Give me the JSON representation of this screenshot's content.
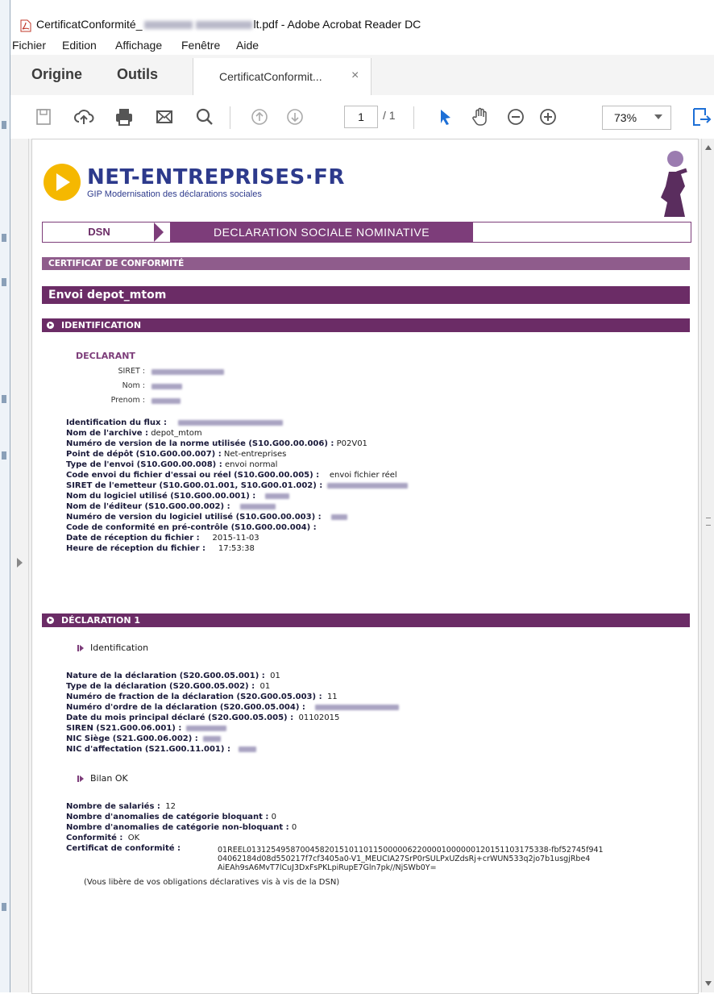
{
  "window": {
    "title_prefix": "CertificatConformité_",
    "title_suffix": "lt.pdf - Adobe Acrobat Reader DC"
  },
  "menu": [
    "Fichier",
    "Edition",
    "Affichage",
    "Fenêtre",
    "Aide"
  ],
  "tabs": {
    "home": "Origine",
    "tools": "Outils",
    "document": "CertificatConformit...",
    "close": "×"
  },
  "toolbar": {
    "page_current": "1",
    "page_total": "/ 1",
    "zoom": "73%"
  },
  "doc": {
    "logo_title": "NET-ENTREPRISES·FR",
    "logo_subtitle": "GIP Modernisation des déclarations sociales",
    "dsn": "DSN",
    "dsn_full": "DECLARATION SOCIALE NOMINATIVE",
    "cert_header": "CERTIFICAT DE CONFORMITÉ",
    "envoi": "Envoi depot_mtom",
    "identification_header": "IDENTIFICATION",
    "declarant": "DECLARANT",
    "declarant_fields": [
      {
        "label": "SIRET :"
      },
      {
        "label": "Nom :"
      },
      {
        "label": "Prenom :"
      }
    ],
    "ident_fields": [
      {
        "label": "Identification du flux :",
        "value": ""
      },
      {
        "label": "Nom de l'archive :",
        "value": "depot_mtom"
      },
      {
        "label": "Numéro de version de la norme utilisée (S10.G00.00.006) :",
        "value": "P02V01"
      },
      {
        "label": "Point de dépôt (S10.G00.00.007) :",
        "value": "Net-entreprises"
      },
      {
        "label": "Type de l'envoi (S10.G00.00.008) :",
        "value": "envoi normal"
      },
      {
        "label": "Code envoi du fichier d'essai ou réel (S10.G00.00.005) :",
        "value": "envoi fichier réel"
      },
      {
        "label": "SIRET de l'emetteur (S10.G00.01.001, S10.G00.01.002) :",
        "value": ""
      },
      {
        "label": "Nom du logiciel utilisé (S10.G00.00.001) :",
        "value": ""
      },
      {
        "label": "Nom de l'éditeur (S10.G00.00.002) :",
        "value": ""
      },
      {
        "label": "Numéro de version du logiciel utilisé (S10.G00.00.003) :",
        "value": ""
      },
      {
        "label": "Code de conformité en pré-contrôle (S10.G00.00.004) :",
        "value": ""
      },
      {
        "label": "Date de réception du fichier :",
        "value": "2015-11-03"
      },
      {
        "label": "Heure de réception du fichier :",
        "value": "17:53:38"
      }
    ],
    "declaration_header": "DÉCLARATION 1",
    "identification_link": "Identification",
    "decl_fields": [
      {
        "label": "Nature de la déclaration (S20.G00.05.001) :",
        "value": "01"
      },
      {
        "label": "Type de la déclaration (S20.G00.05.002) :",
        "value": "01"
      },
      {
        "label": "Numéro de fraction de la déclaration (S20.G00.05.003) :",
        "value": "11"
      },
      {
        "label": "Numéro d'ordre de la déclaration (S20.G00.05.004) :",
        "value": ""
      },
      {
        "label": "Date du mois principal déclaré (S20.G00.05.005) :",
        "value": "01102015"
      },
      {
        "label": "SIREN (S21.G00.06.001) :",
        "value": ""
      },
      {
        "label": "NIC Siège (S21.G00.06.002) :",
        "value": ""
      },
      {
        "label": "NIC d'affectation (S21.G00.11.001) :",
        "value": ""
      }
    ],
    "bilan_link": "Bilan OK",
    "bilan_fields": [
      {
        "label": "Nombre de salariés :",
        "value": "12"
      },
      {
        "label": "Nombre d'anomalies de catégorie bloquant :",
        "value": "0"
      },
      {
        "label": "Nombre d'anomalies de catégorie non-bloquant :",
        "value": "0"
      },
      {
        "label": "Conformité :",
        "value": "OK"
      }
    ],
    "cert_label": "Certificat de conformité :",
    "cert_lines": [
      "01REEL01312549587004582015101101150000062200001000000120151103175338-fbf52745f941",
      "04062184d08d550217f7cf3405a0-V1_MEUCIA27SrP0rSULPxUZdsRj+crWUN533q2jo7b1usgjRbe4",
      "AiEAh9sA6MvT7lCuJ3DxFsPKLpiRupE7Gln7pk//NjSWb0Y="
    ],
    "note": "(Vous libère de vos obligations déclaratives vis à vis de la DSN)"
  }
}
